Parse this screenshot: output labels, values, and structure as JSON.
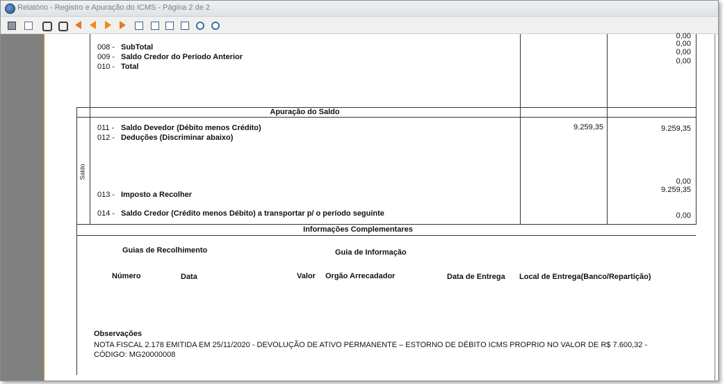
{
  "window": {
    "title": "Relatório - Registro e Apuração do ICMS - Página 2 de 2"
  },
  "toolbar": {
    "buttons": [
      {
        "icon": "print-icon"
      },
      {
        "icon": "page-setup-icon"
      },
      {
        "icon": "find-icon"
      },
      {
        "icon": "find-next-icon"
      },
      {
        "icon": "first-page-icon"
      },
      {
        "icon": "previous-page-icon"
      },
      {
        "icon": "next-page-icon"
      },
      {
        "icon": "last-page-icon"
      },
      {
        "icon": "page-width-icon"
      },
      {
        "icon": "full-page-icon"
      },
      {
        "icon": "two-pages-icon"
      },
      {
        "icon": "multi-pages-icon"
      },
      {
        "icon": "zoom-in-icon"
      },
      {
        "icon": "zoom-out-icon"
      }
    ]
  },
  "report": {
    "top_values": [
      "0,00",
      "0,00",
      "0,00",
      "0,00"
    ],
    "top_rows": [
      {
        "code": "008 -",
        "label": "SubTotal"
      },
      {
        "code": "009 -",
        "label": "Saldo Credor do Período Anterior"
      },
      {
        "code": "010 -",
        "label": "Total"
      }
    ],
    "apuracao_title": "Apuração do Saldo",
    "side_label": "Saldo",
    "saldo_rows": [
      {
        "code": "011 -",
        "label": "Saldo Devedor (Débito menos Crédito)",
        "value1": "9.259,35",
        "value2": "9.259,35"
      },
      {
        "code": "012 -",
        "label": "Deduções (Discriminar abaixo)",
        "value1": "",
        "value2": ""
      },
      {
        "code": "013 -",
        "label": "Imposto a Recolher",
        "value1": "",
        "value2_a": "0,00",
        "value2_b": "9.259,35"
      },
      {
        "code": "014 -",
        "label": "Saldo Credor (Crédito menos Débito) a transportar p/ o período seguinte",
        "value1": "",
        "value2": "0,00"
      }
    ],
    "info_title": "Informações Complementares",
    "guias_recolhimento": "Guias de Recolhimento",
    "guia_informacao": "Guia de Informação",
    "columns": {
      "numero": "Número",
      "data": "Data",
      "valor": "Valor",
      "orgao": "Orgão Arrecadador",
      "data_entrega": "Data de Entrega",
      "local_entrega": "Local de Entrega(Banco/Repartição)"
    },
    "observacoes_title": "Observações",
    "observacoes_line1": "NOTA FISCAL 2.178 EMITIDA EM 25/11/2020 - DEVOLUÇÃO DE ATIVO PERMANENTE – ESTORNO DE DÉBITO ICMS PROPRIO NO VALOR DE R$ 7.600,32 -",
    "observacoes_line2": "CÓDIGO: MG20000008"
  }
}
